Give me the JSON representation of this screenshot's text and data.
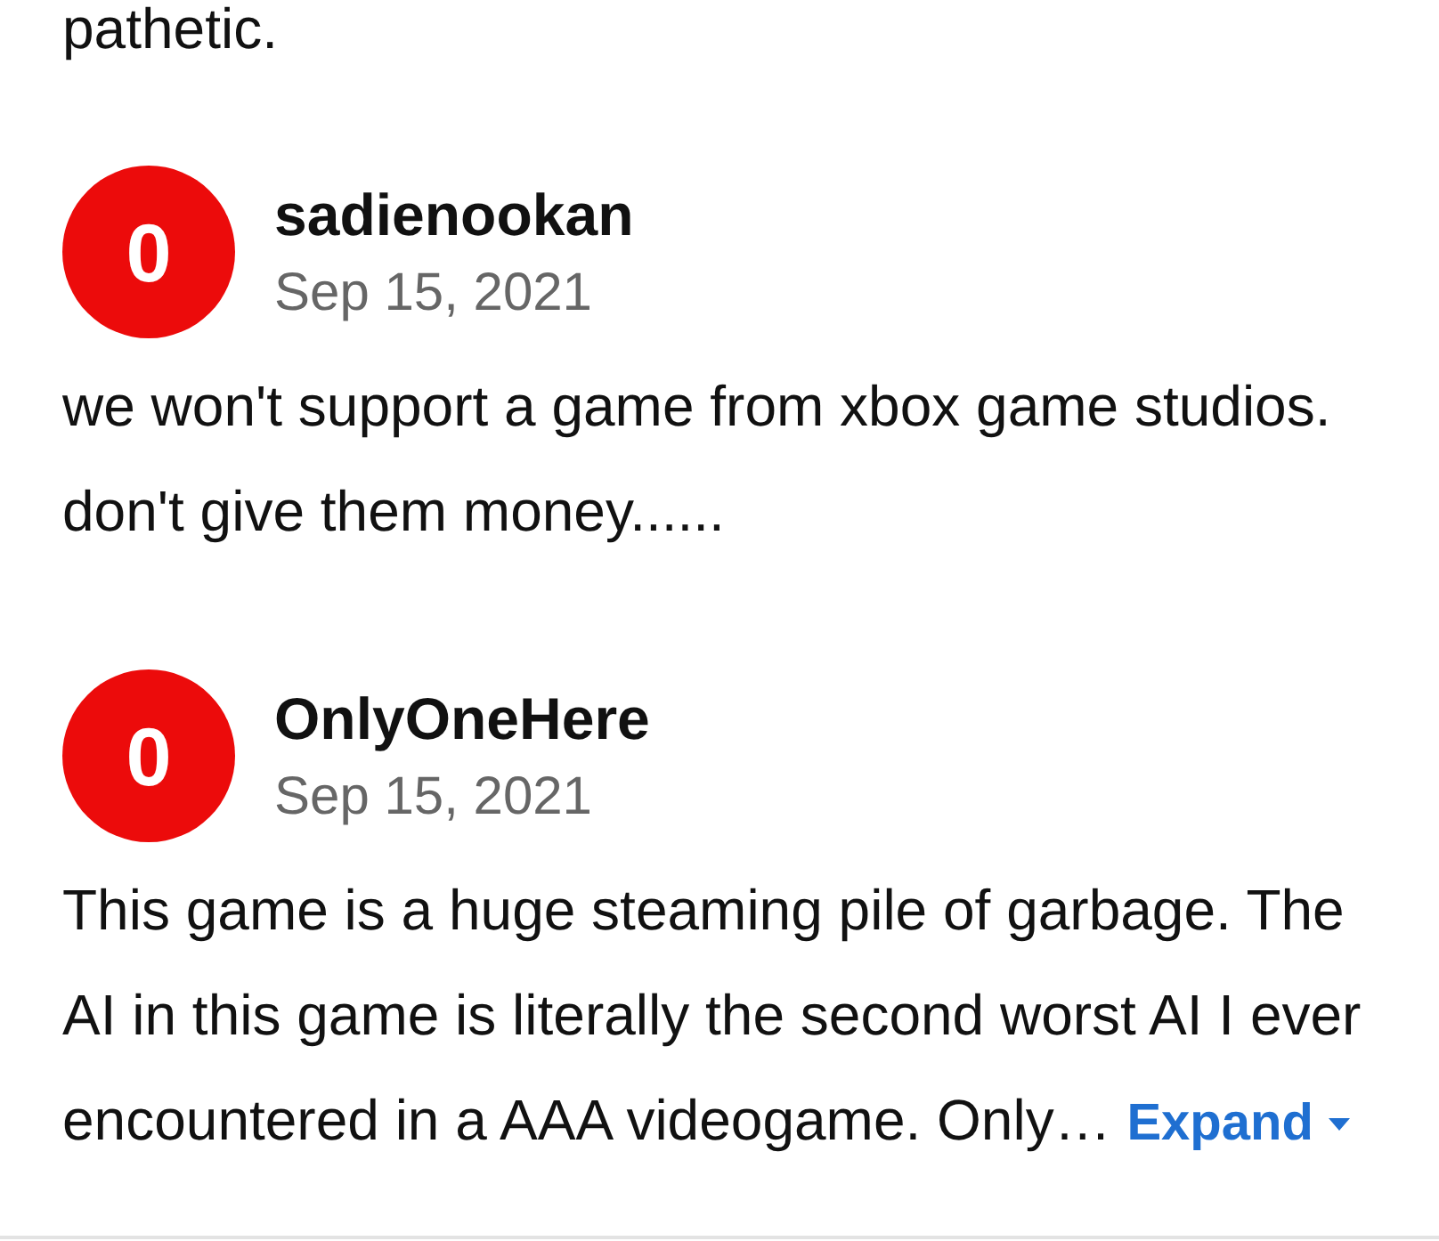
{
  "previous_review": {
    "text": "pathetic."
  },
  "reviews": [
    {
      "score": "0",
      "username": "sadienookan",
      "date": "Sep 15, 2021",
      "text": "we won't support a game from xbox game studios. don't give them money......"
    },
    {
      "score": "0",
      "username": "OnlyOneHere",
      "date": "Sep 15, 2021",
      "text": "This game is a huge steaming pile of garbage. The AI in this game is literally the second worst AI I ever encountered in a AAA videogame. Only…",
      "expand_link": "Expand"
    }
  ]
}
